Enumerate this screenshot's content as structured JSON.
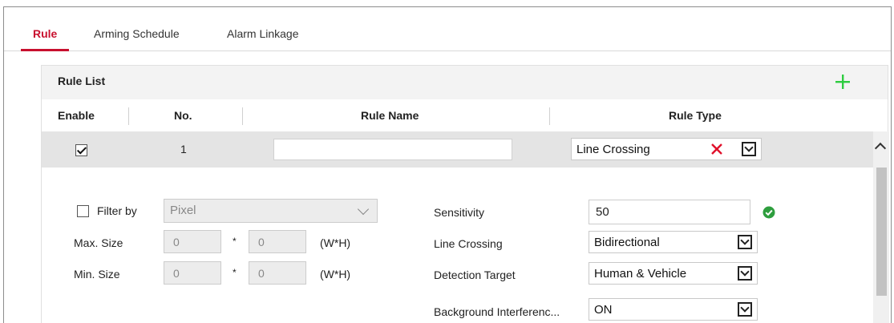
{
  "tabs": [
    {
      "label": "Rule",
      "active": true
    },
    {
      "label": "Arming Schedule",
      "active": false
    },
    {
      "label": "Alarm Linkage",
      "active": false
    }
  ],
  "rule_list": {
    "title": "Rule List",
    "columns": {
      "enable": "Enable",
      "no": "No.",
      "rule_name": "Rule Name",
      "rule_type": "Rule Type"
    },
    "rows": [
      {
        "enabled": true,
        "no": "1",
        "name": "",
        "type": "Line Crossing"
      }
    ]
  },
  "detail": {
    "filter_label": "Filter by",
    "filter_checked": false,
    "filter_value": "Pixel",
    "max_size_label": "Max. Size",
    "max_w": "0",
    "max_h": "0",
    "min_size_label": "Min. Size",
    "min_w": "0",
    "min_h": "0",
    "times": "*",
    "wh_unit": "(W*H)",
    "sensitivity_label": "Sensitivity",
    "sensitivity_value": "50",
    "line_crossing_label": "Line Crossing",
    "line_crossing_value": "Bidirectional",
    "detection_target_label": "Detection Target",
    "detection_target_value": "Human & Vehicle",
    "bg_interference_label": "Background Interferenc...",
    "bg_interference_value": "ON"
  },
  "colors": {
    "accent": "#c8102e",
    "add": "#2ecc40",
    "delete": "#e0112b",
    "ok": "#2e9e3e"
  },
  "icons": [
    "add-icon",
    "delete-icon",
    "check-circle-icon",
    "chevron-down-icon",
    "scroll-up-icon"
  ]
}
